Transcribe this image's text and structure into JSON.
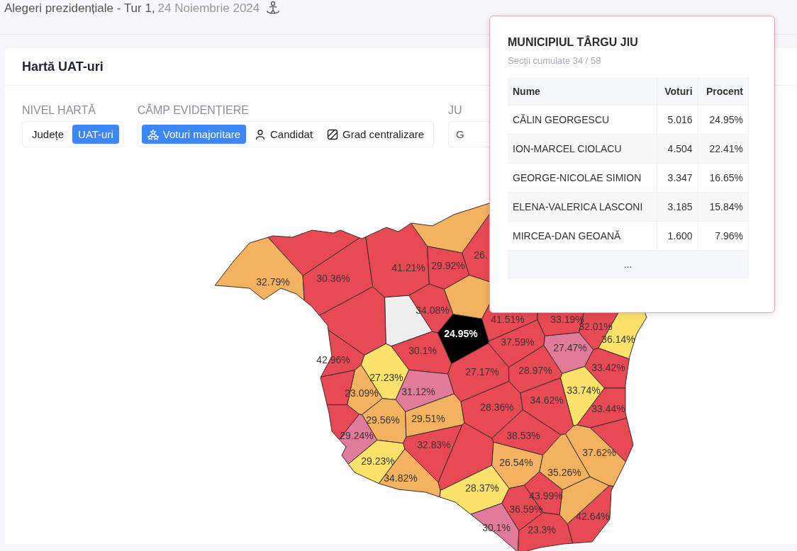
{
  "header": {
    "title": "Alegeri prezidențiale - Tur 1,",
    "date": "24 Noiembrie 2024"
  },
  "card": {
    "title": "Hartă UAT-uri"
  },
  "controls": [
    {
      "kind": "segmented",
      "label": "NIVEL HARTĂ",
      "options": [
        {
          "text": "Județe",
          "selected": false
        },
        {
          "text": "UAT-uri",
          "selected": true
        }
      ]
    },
    {
      "kind": "segmented",
      "label": "CÂMP EVIDENȚIERE",
      "options": [
        {
          "text": "Voturi majoritare",
          "selected": true
        },
        {
          "text": "Candidat",
          "selected": false
        },
        {
          "text": "Grad centralizare",
          "selected": false
        }
      ]
    },
    {
      "kind": "select",
      "label": "JU",
      "value": "G"
    }
  ],
  "map": {
    "regions": [
      {
        "label": "32.79%",
        "color": "#f2b25f"
      },
      {
        "label": "30.36%",
        "color": "#e84a55"
      },
      {
        "label": "41.21%",
        "color": "#e84a55"
      },
      {
        "label": "29.92%",
        "color": "#e84a55"
      },
      {
        "label": "26.",
        "color": "#e84a55"
      },
      {
        "label": "34.08%",
        "color": "#e84a55"
      },
      {
        "color": "#eeeeee"
      },
      {
        "label": "24.95%",
        "color": "#000000"
      },
      {
        "color": "#f2b25f"
      },
      {
        "label": "41.51%",
        "color": "#e84a55"
      },
      {
        "label": "33.19%",
        "color": "#e84a55"
      },
      {
        "label": "32.01%",
        "color": "#e84a55"
      },
      {
        "label": "36.14%",
        "color": "#fbe36b"
      },
      {
        "label": "37.59%",
        "color": "#e84a55"
      },
      {
        "label": "27.47%",
        "color": "#e07c9a"
      },
      {
        "label": "30.1%",
        "color": "#e84a55"
      },
      {
        "label": "42.96%",
        "color": "#e84a55"
      },
      {
        "label": "27.23%",
        "color": "#fbe36b"
      },
      {
        "label": "27.17%",
        "color": "#e84a55"
      },
      {
        "label": "28.97%",
        "color": "#e84a55"
      },
      {
        "label": "33.42%",
        "color": "#e84a55"
      },
      {
        "label": "23.09%",
        "color": "#f2b25f"
      },
      {
        "label": "31.12%",
        "color": "#e07c9a"
      },
      {
        "label": "33.74%",
        "color": "#fbe36b"
      },
      {
        "label": "34.62%",
        "color": "#e84a55"
      },
      {
        "label": "28.36%",
        "color": "#e84a55"
      },
      {
        "label": "33.44%",
        "color": "#e84a55"
      },
      {
        "label": "29.56%",
        "color": "#f2b25f"
      },
      {
        "label": "29.51%",
        "color": "#f2b25f"
      },
      {
        "label": "29.24%",
        "color": "#e07c9a"
      },
      {
        "label": "38.53%",
        "color": "#e84a55"
      },
      {
        "label": "32.83%",
        "color": "#e84a55"
      },
      {
        "label": "37.62%",
        "color": "#f2b25f"
      },
      {
        "label": "29.23%",
        "color": "#fbe36b"
      },
      {
        "label": "26.54%",
        "color": "#f2b25f"
      },
      {
        "label": "35.26%",
        "color": "#f2b25f"
      },
      {
        "label": "34.82%",
        "color": "#f2b25f"
      },
      {
        "label": "28.37%",
        "color": "#fbe36b"
      },
      {
        "label": "43.99%",
        "color": "#e84a55"
      },
      {
        "label": "36.59%",
        "color": "#e84a55"
      },
      {
        "label": "42.64%",
        "color": "#e84a55"
      },
      {
        "label": "30.1%",
        "color": "#e07c9a"
      },
      {
        "label": "23.3%",
        "color": "#e84a55"
      },
      {
        "color": "#e84a55"
      },
      {
        "color": "#e84a55"
      },
      {
        "color": "#e84a55"
      },
      {
        "color": "#f2b25f"
      },
      {
        "color": "#e84a55"
      },
      {
        "color": "#e84a55"
      },
      {
        "color": "#f2b25f"
      },
      {
        "color": "#e84a55"
      }
    ]
  },
  "tooltip": {
    "title": "MUNICIPIUL TÂRGU JIU",
    "subtitle": "Secții cumulate 34 / 58",
    "columns": [
      "Nume",
      "Voturi",
      "Procent"
    ],
    "rows": [
      [
        "CĂLIN GEORGESCU",
        "5.016",
        "24.95%"
      ],
      [
        "ION-MARCEL CIOLACU",
        "4.504",
        "22.41%"
      ],
      [
        "GEORGE-NICOLAE SIMION",
        "3.347",
        "16.65%"
      ],
      [
        "ELENA-VALERICA LASCONI",
        "3.185",
        "15.84%"
      ],
      [
        "MIRCEA-DAN GEOANĂ",
        "1.600",
        "7.96%"
      ]
    ],
    "more": "..."
  }
}
